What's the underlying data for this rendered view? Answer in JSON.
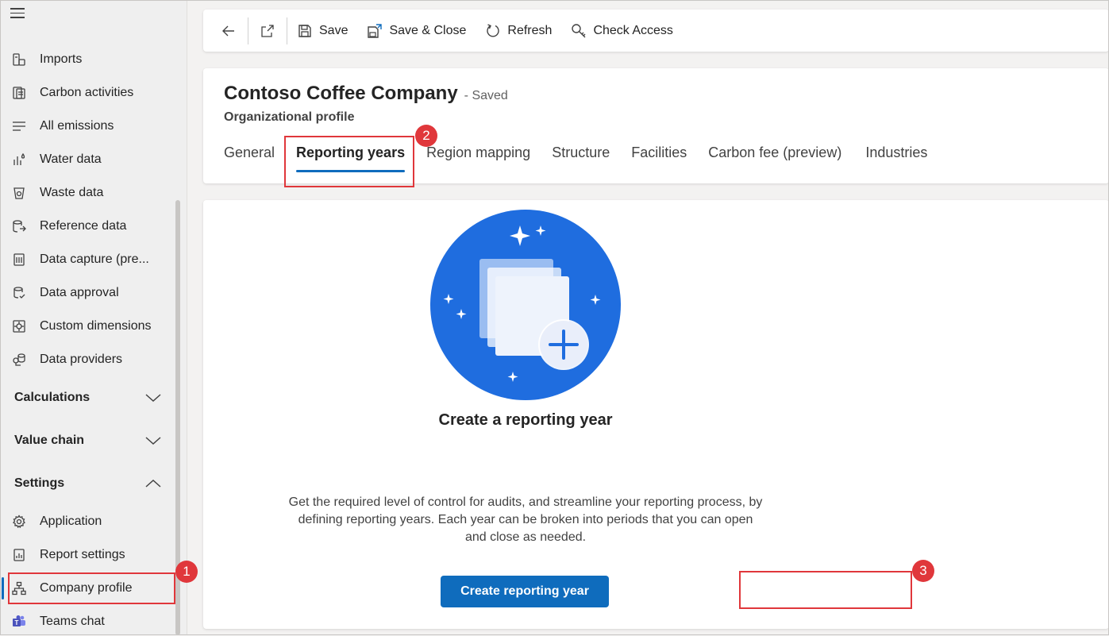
{
  "sidebar": {
    "items": [
      {
        "label": "Imports",
        "icon": "imports-icon"
      },
      {
        "label": "Carbon activities",
        "icon": "carbon-activities-icon"
      },
      {
        "label": "All emissions",
        "icon": "all-emissions-icon"
      },
      {
        "label": "Water data",
        "icon": "water-data-icon"
      },
      {
        "label": "Waste data",
        "icon": "waste-data-icon"
      },
      {
        "label": "Reference data",
        "icon": "reference-data-icon"
      },
      {
        "label": "Data capture (pre...",
        "icon": "data-capture-icon"
      },
      {
        "label": "Data approval",
        "icon": "data-approval-icon"
      },
      {
        "label": "Custom dimensions",
        "icon": "custom-dimensions-icon"
      },
      {
        "label": "Data providers",
        "icon": "data-providers-icon"
      }
    ],
    "groups": [
      {
        "label": "Calculations",
        "state": "collapsed"
      },
      {
        "label": "Value chain",
        "state": "collapsed"
      },
      {
        "label": "Settings",
        "state": "expanded"
      }
    ],
    "settings_items": [
      {
        "label": "Application",
        "icon": "gear-icon"
      },
      {
        "label": "Report settings",
        "icon": "report-settings-icon"
      },
      {
        "label": "Company profile",
        "icon": "org-chart-icon",
        "selected": true
      },
      {
        "label": "Teams chat",
        "icon": "teams-icon"
      }
    ]
  },
  "commandbar": {
    "save": "Save",
    "save_close": "Save & Close",
    "refresh": "Refresh",
    "check_access": "Check Access"
  },
  "record": {
    "title": "Contoso Coffee Company",
    "status": "- Saved",
    "subtitle": "Organizational profile"
  },
  "tabs": [
    "General",
    "Reporting years",
    "Region mapping",
    "Structure",
    "Facilities",
    "Carbon fee (preview)",
    "Industries"
  ],
  "active_tab": "Reporting years",
  "empty_state": {
    "title": "Create a reporting year",
    "description": "Get the required level of control for audits, and streamline your reporting process, by defining reporting years. Each year can be broken into periods that you can open and close as needed.",
    "button": "Create reporting year"
  },
  "callouts": [
    "1",
    "2",
    "3"
  ],
  "colors": {
    "accent": "#0f6cbd",
    "callout": "#e0373b",
    "illustration": "#1f6ddf"
  }
}
